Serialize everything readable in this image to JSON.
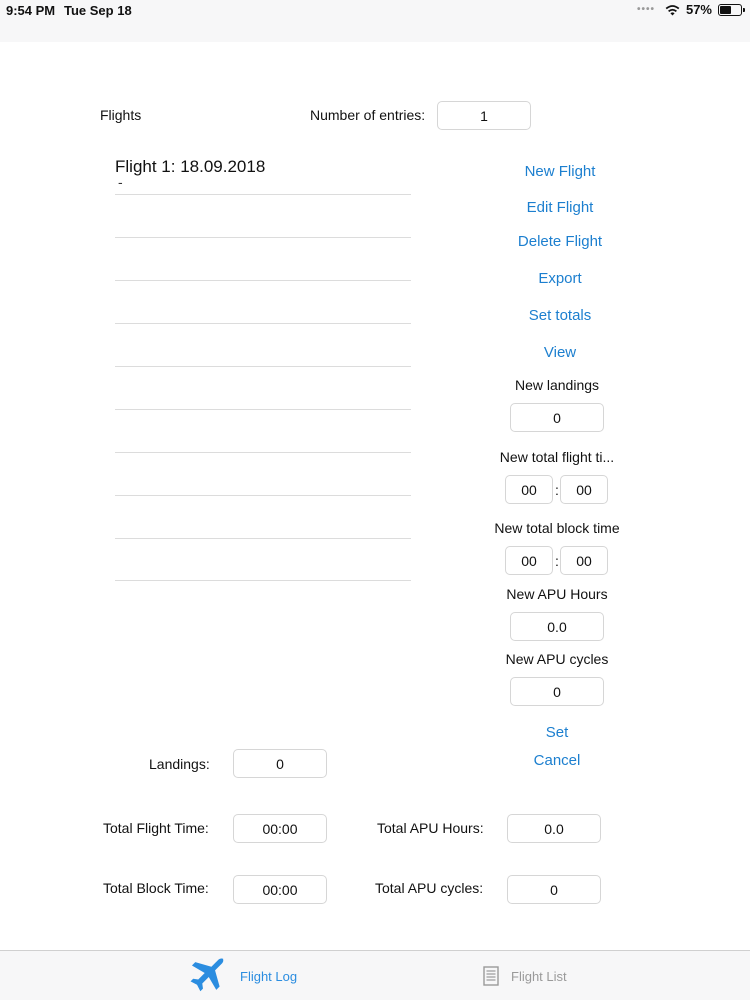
{
  "status_bar": {
    "time": "9:54 PM",
    "date": "Tue Sep 18",
    "battery": "57%",
    "battery_level": 0.57
  },
  "header": {
    "flights_label": "Flights",
    "entries_label": "Number of entries:",
    "entries_value": "1"
  },
  "flight_list": {
    "items": [
      {
        "label": "Flight 1: 18.09.2018",
        "sub": "-"
      }
    ]
  },
  "actions": {
    "new_flight": "New Flight",
    "edit_flight": "Edit Flight",
    "delete_flight": "Delete Flight",
    "export": "Export",
    "set_totals": "Set totals",
    "view": "View"
  },
  "set_totals_panel": {
    "new_landings_label": "New landings",
    "new_landings_value": "0",
    "new_flight_time_label": "New total flight ti...",
    "new_flight_time_hours": "00",
    "new_flight_time_minutes": "00",
    "new_block_time_label": "New total block time",
    "new_block_time_hours": "00",
    "new_block_time_minutes": "00",
    "new_apu_hours_label": "New APU Hours",
    "new_apu_hours_value": "0.0",
    "new_apu_cycles_label": "New APU cycles",
    "new_apu_cycles_value": "0",
    "time_separator": ":",
    "set_label": "Set",
    "cancel_label": "Cancel"
  },
  "totals": {
    "landings_label": "Landings:",
    "landings_value": "0",
    "flight_time_label": "Total Flight Time:",
    "flight_time_value": "00:00",
    "block_time_label": "Total Block Time:",
    "block_time_value": "00:00",
    "apu_hours_label": "Total APU Hours:",
    "apu_hours_value": "0.0",
    "apu_cycles_label": "Total APU cycles:",
    "apu_cycles_value": "0"
  },
  "tab_bar": {
    "tabs": [
      {
        "label": "Flight Log",
        "icon": "airplane-icon",
        "active": true
      },
      {
        "label": "Flight List",
        "icon": "list-icon",
        "active": false
      }
    ]
  },
  "colors": {
    "accent": "#1c7fcf",
    "tab_active": "#2b8de0",
    "tab_inactive": "#9a9a9a"
  }
}
